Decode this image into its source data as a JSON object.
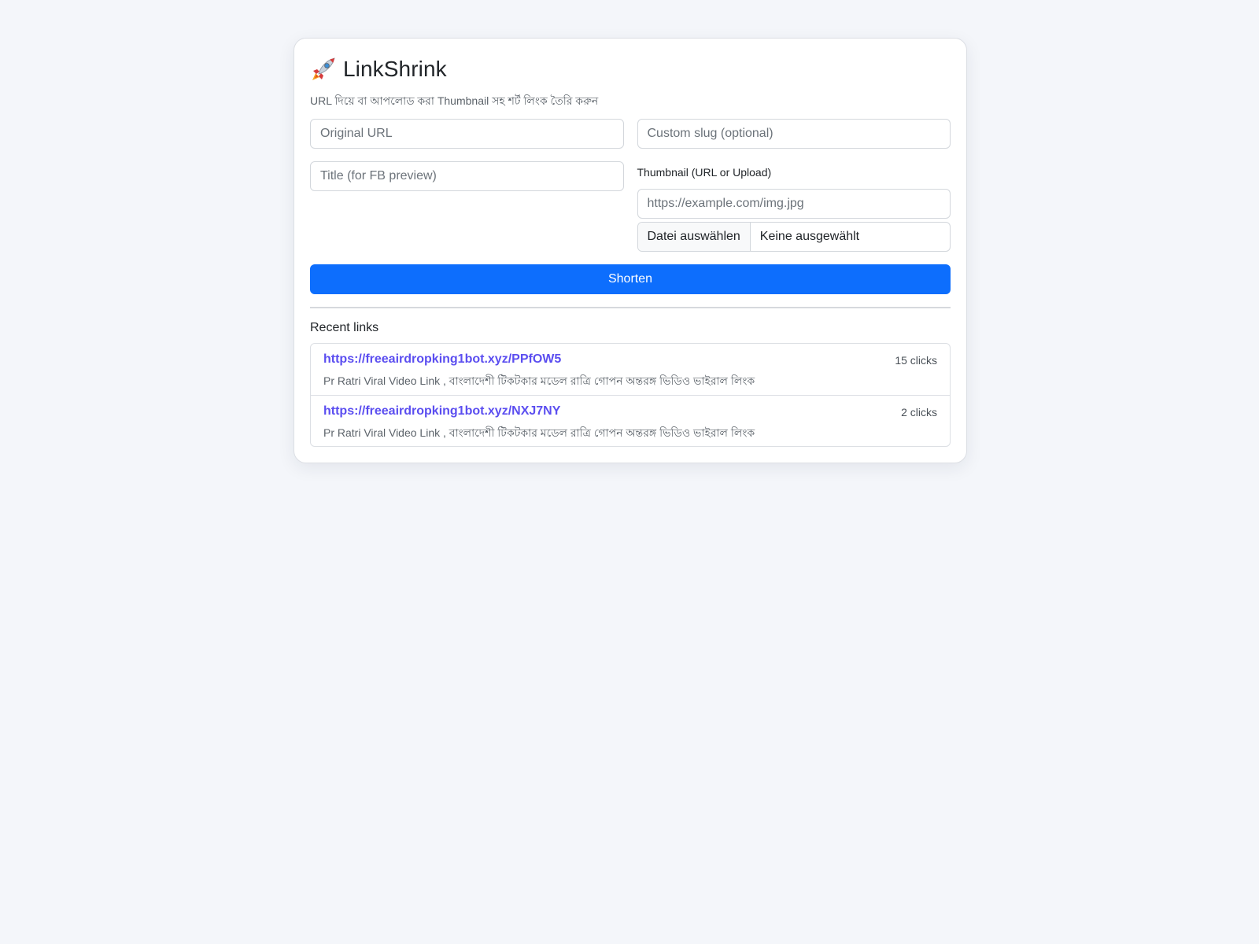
{
  "app": {
    "icon": "rocket-icon",
    "title": "LinkShrink",
    "subtitle": "URL দিয়ে বা আপলোড করা Thumbnail সহ শর্ট লিংক তৈরি করুন"
  },
  "form": {
    "original_url": {
      "value": "",
      "placeholder": "Original URL"
    },
    "custom_slug": {
      "value": "",
      "placeholder": "Custom slug (optional)"
    },
    "title": {
      "value": "",
      "placeholder": "Title (for FB preview)"
    },
    "thumbnail_label": "Thumbnail (URL or Upload)",
    "thumbnail_url": {
      "value": "",
      "placeholder": "https://example.com/img.jpg"
    },
    "file_button_label": "Datei auswählen",
    "file_status": "Keine ausgewählt",
    "submit_label": "Shorten"
  },
  "recent": {
    "heading": "Recent links",
    "items": [
      {
        "url": "https://freeairdropking1bot.xyz/PPfOW5",
        "title": "Pr Ratri Viral Video Link , বাংলাদেশী টিকটকার মডেল রাত্রি গোপন অন্তরঙ্গ ভিডিও ভাইরাল লিংক",
        "clicks": "15 clicks"
      },
      {
        "url": "https://freeairdropking1bot.xyz/NXJ7NY",
        "title": "Pr Ratri Viral Video Link , বাংলাদেশী টিকটকার মডেল রাত্রি গোপন অন্তরঙ্গ ভিডিও ভাইরাল লিংক",
        "clicks": "2 clicks"
      }
    ]
  },
  "colors": {
    "background": "#f4f6fa",
    "primary": "#0d6efd",
    "link": "#5b4ef0"
  }
}
